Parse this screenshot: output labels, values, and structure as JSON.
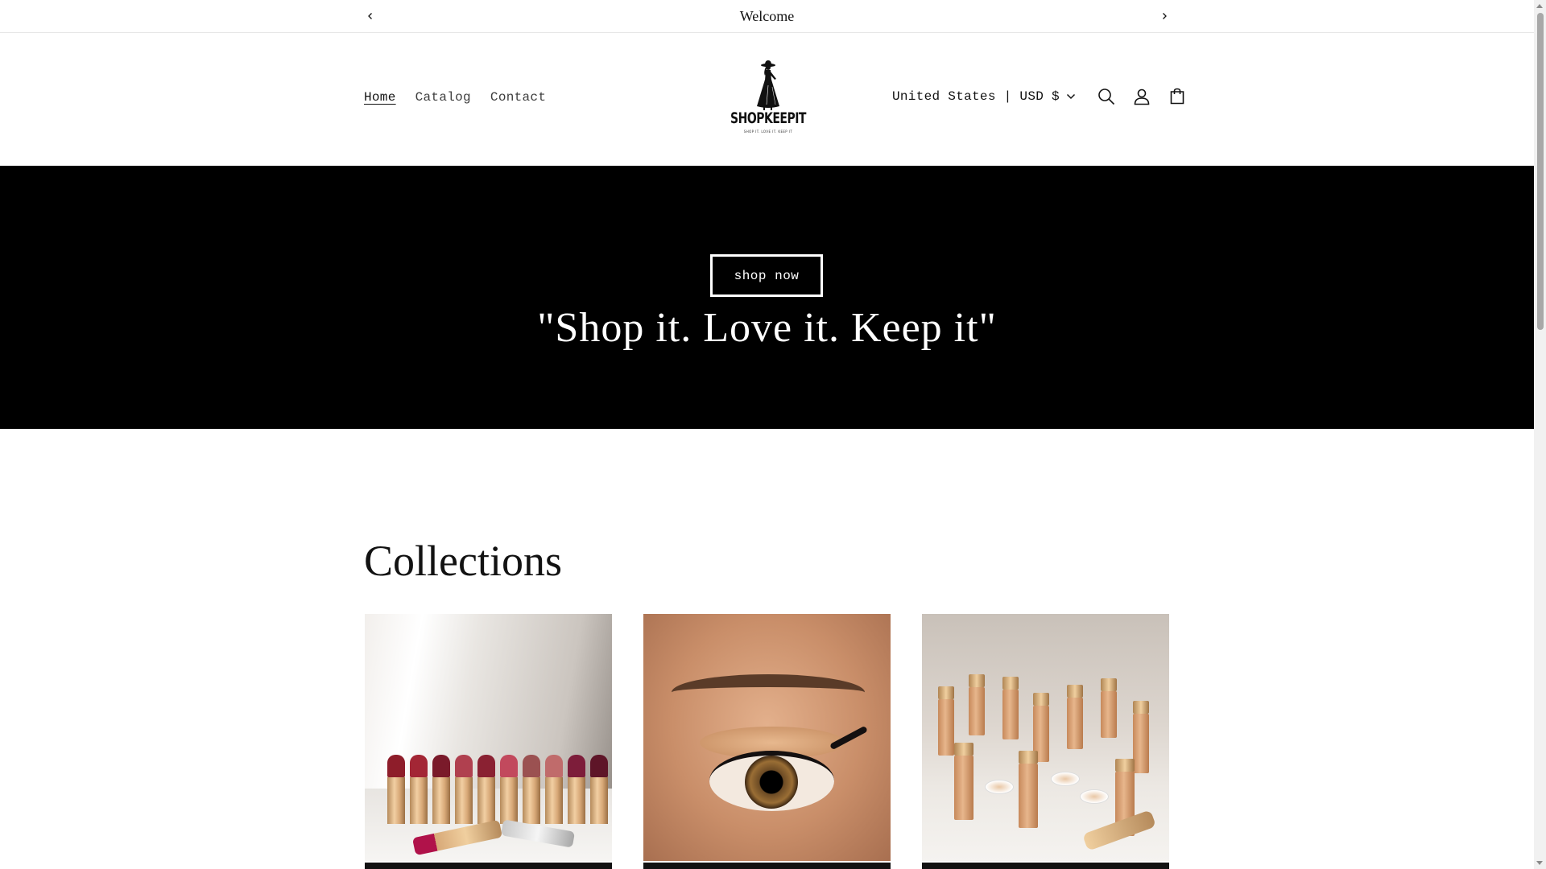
{
  "announcement": {
    "text": "Welcome",
    "prev_icon": "chevron-left-icon",
    "next_icon": "chevron-right-icon"
  },
  "header": {
    "nav": [
      {
        "label": "Home",
        "active": true
      },
      {
        "label": "Catalog",
        "active": false
      },
      {
        "label": "Contact",
        "active": false
      }
    ],
    "logo": {
      "wordmark": "SHOPKEEPIT",
      "tagline": "SHOP IT. LOVE IT. KEEP IT"
    },
    "country_selector": "United States | USD $",
    "icons": [
      "search-icon",
      "account-icon",
      "cart-icon"
    ]
  },
  "hero": {
    "button_label": "shop now",
    "headline": "\"Shop it. Love it. Keep it\"",
    "background": "#000000"
  },
  "collections": {
    "heading": "Collections",
    "cards": [
      {
        "image": "lipsticks"
      },
      {
        "image": "eye-makeup"
      },
      {
        "image": "foundation"
      }
    ]
  },
  "colors": {
    "text": "#121212",
    "hero_bg": "#000000",
    "hero_text": "#ffffff"
  }
}
